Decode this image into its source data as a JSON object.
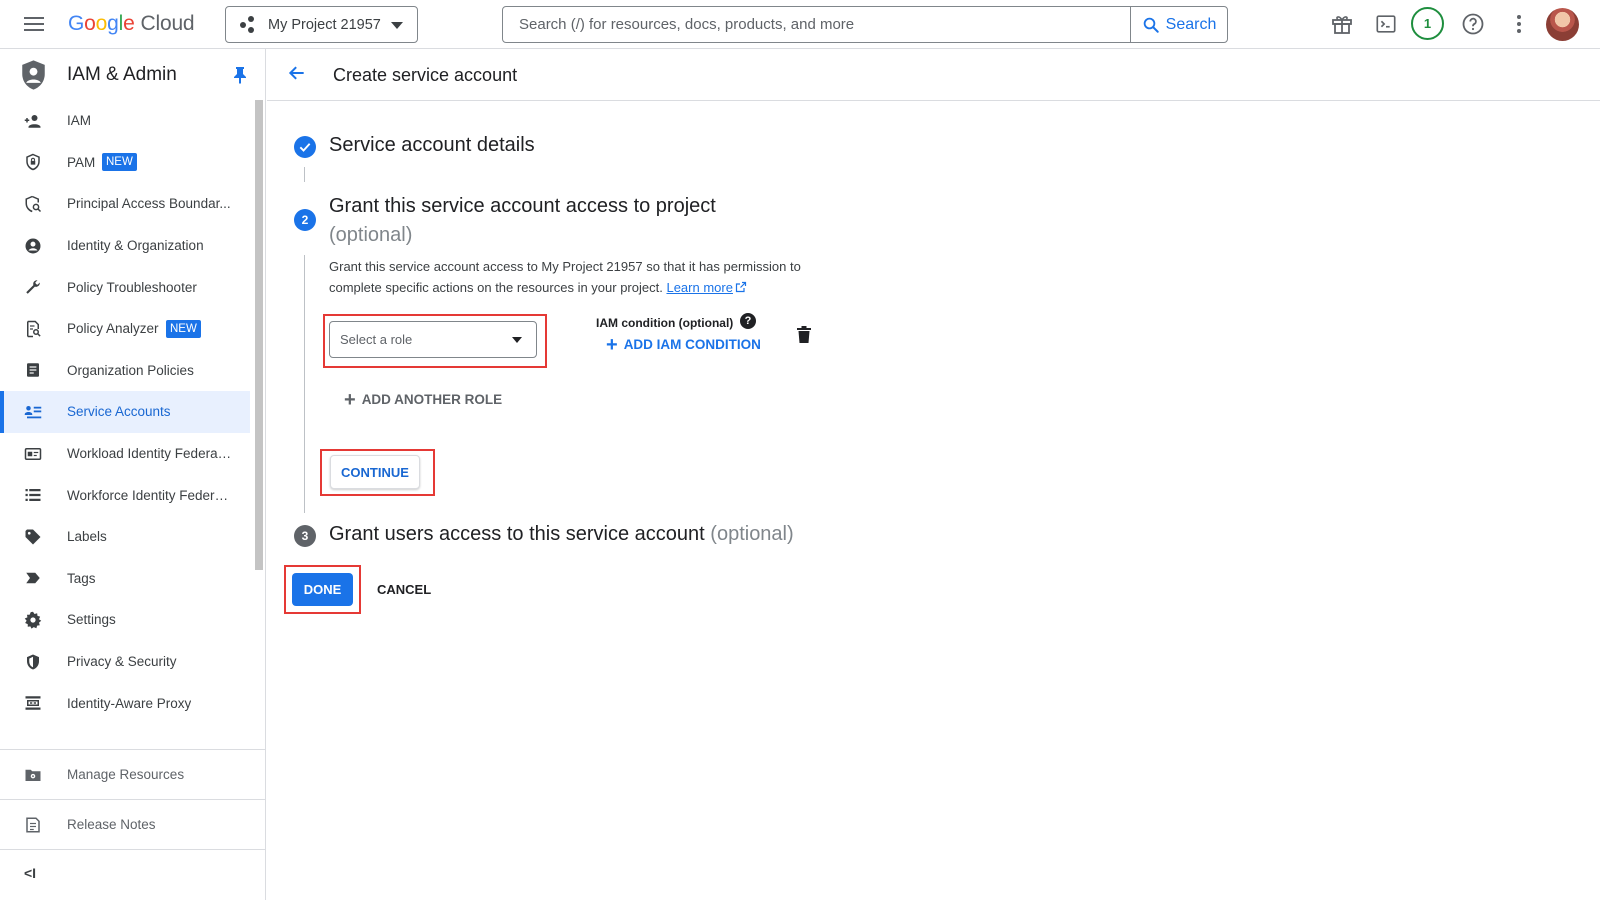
{
  "topbar": {
    "logo_letters": [
      "G",
      "o",
      "o",
      "g",
      "l",
      "e"
    ],
    "logo_product": "Cloud",
    "project_name": "My Project 21957",
    "search_placeholder": "Search (/) for resources, docs, products, and more",
    "search_button": "Search",
    "notification_count": "1"
  },
  "sidebar": {
    "title": "IAM & Admin",
    "items": [
      {
        "label": "IAM",
        "icon": "person-add-icon"
      },
      {
        "label": "PAM",
        "icon": "shield-lock-icon",
        "badge": "NEW"
      },
      {
        "label": "Principal Access Boundar...",
        "icon": "shield-search-icon"
      },
      {
        "label": "Identity & Organization",
        "icon": "account-circle-icon"
      },
      {
        "label": "Policy Troubleshooter",
        "icon": "wrench-icon"
      },
      {
        "label": "Policy Analyzer",
        "icon": "document-search-icon",
        "badge": "NEW"
      },
      {
        "label": "Organization Policies",
        "icon": "document-icon"
      },
      {
        "label": "Service Accounts",
        "icon": "service-account-icon",
        "active": true
      },
      {
        "label": "Workload Identity Federat...",
        "icon": "id-card-icon"
      },
      {
        "label": "Workforce Identity Federa...",
        "icon": "list-icon"
      },
      {
        "label": "Labels",
        "icon": "tag-icon"
      },
      {
        "label": "Tags",
        "icon": "label-arrow-icon"
      },
      {
        "label": "Settings",
        "icon": "gear-icon"
      },
      {
        "label": "Privacy & Security",
        "icon": "shield-icon"
      },
      {
        "label": "Identity-Aware Proxy",
        "icon": "proxy-icon"
      }
    ],
    "manage_resources": "Manage Resources",
    "release_notes": "Release Notes",
    "collapse": "<I"
  },
  "page": {
    "title": "Create service account"
  },
  "steps": {
    "step1_title": "Service account details",
    "step2_number": "2",
    "step2_title": "Grant this service account access to project",
    "step2_optional": "(optional)",
    "step2_desc": "Grant this service account access to My Project 21957 so that it has permission to complete specific actions on the resources in your project.",
    "learn_more": "Learn more",
    "role_placeholder": "Select a role",
    "iam_condition_label": "IAM condition (optional)",
    "help_glyph": "?",
    "add_iam_condition": "ADD IAM CONDITION",
    "add_another_role": "ADD ANOTHER ROLE",
    "continue": "CONTINUE",
    "step3_number": "3",
    "step3_title": "Grant users access to this service account",
    "step3_optional": "(optional)"
  },
  "actions": {
    "done": "DONE",
    "cancel": "CANCEL"
  },
  "colors": {
    "accent": "#1a73e8",
    "highlight_box": "#e53935",
    "step_complete": "#1a73e8",
    "step_pending": "#5f6368"
  }
}
